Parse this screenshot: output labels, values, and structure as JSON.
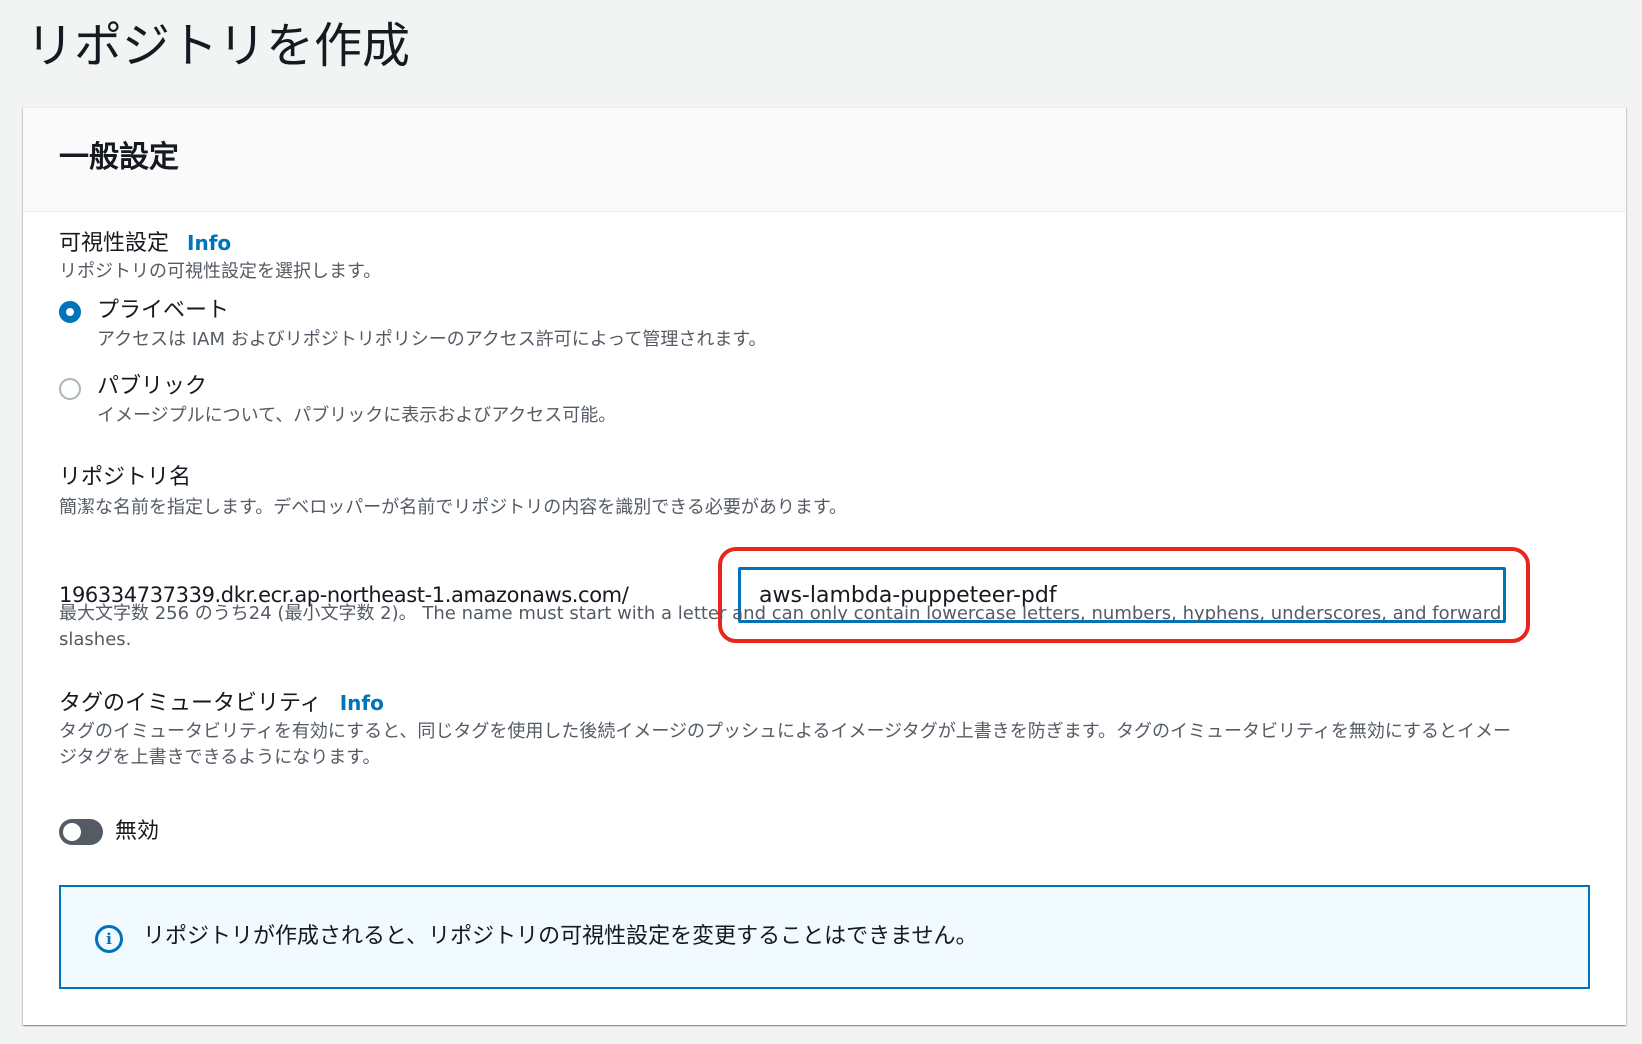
{
  "page": {
    "title": "リポジトリを作成"
  },
  "general": {
    "title": "一般設定",
    "visibility": {
      "label": "可視性設定",
      "info": "Info",
      "description": "リポジトリの可視性設定を選択します。",
      "options": [
        {
          "label": "プライベート",
          "description": "アクセスは IAM およびリポジトリポリシーのアクセス許可によって管理されます。",
          "selected": true
        },
        {
          "label": "パブリック",
          "description": "イメージプルについて、パブリックに表示およびアクセス可能。",
          "selected": false
        }
      ]
    },
    "repo_name": {
      "label": "リポジトリ名",
      "description": "簡潔な名前を指定します。デベロッパーが名前でリポジトリの内容を識別できる必要があります。",
      "prefix": "196334737339.dkr.ecr.ap-northeast-1.amazonaws.com/",
      "value": "aws-lambda-puppeteer-pdf",
      "hint": "最大文字数 256 のうち24 (最小文字数 2)。 The name must start with a letter and can only contain lowercase letters, numbers, hyphens, underscores, and forward slashes."
    },
    "tag_immutability": {
      "label": "タグのイミュータビリティ",
      "info": "Info",
      "description": "タグのイミュータビリティを有効にすると、同じタグを使用した後続イメージのプッシュによるイメージタグが上書きを防ぎます。タグのイミュータビリティを無効にするとイメージタグを上書きできるようになります。",
      "toggle_label": "無効",
      "enabled": false
    },
    "alert": {
      "icon": "info-icon",
      "text": "リポジトリが作成されると、リポジトリの可視性設定を変更することはできません。"
    }
  },
  "colors": {
    "accent": "#0073bb",
    "highlight": "#e8261c",
    "background": "#f2f3f3"
  }
}
